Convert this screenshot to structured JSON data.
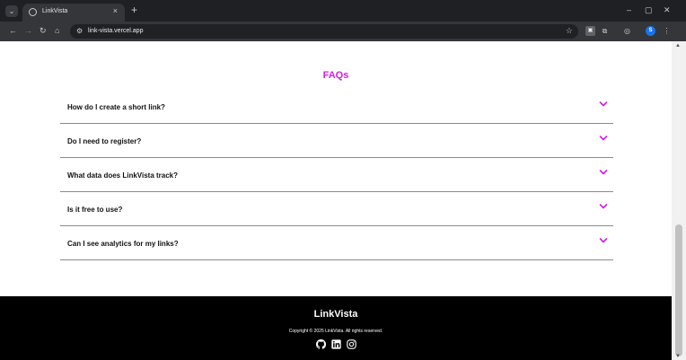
{
  "browser": {
    "tab_title": "LinkVista",
    "tab_close": "×",
    "new_tab": "+",
    "url": "link-vista.vercel.app",
    "profile_initial": "S",
    "window_minimize": "–",
    "window_maximize": "▢",
    "window_close": "✕"
  },
  "faq": {
    "title": "FAQs",
    "items": [
      {
        "question": "How do I create a short link?"
      },
      {
        "question": "Do I need to register?"
      },
      {
        "question": "What data does LinkVista track?"
      },
      {
        "question": "Is it free to use?"
      },
      {
        "question": "Can I see analytics for my links?"
      }
    ]
  },
  "footer": {
    "brand": "LinkVista",
    "copyright": "Copyright © 2025 LinkVista. All rights reserved.",
    "socials": [
      "github-icon",
      "linkedin-icon",
      "instagram-icon"
    ]
  },
  "colors": {
    "accent": "#d21fe0",
    "footer_bg": "#000000",
    "chrome_bg": "#1f2024",
    "toolbar_bg": "#35363a"
  }
}
